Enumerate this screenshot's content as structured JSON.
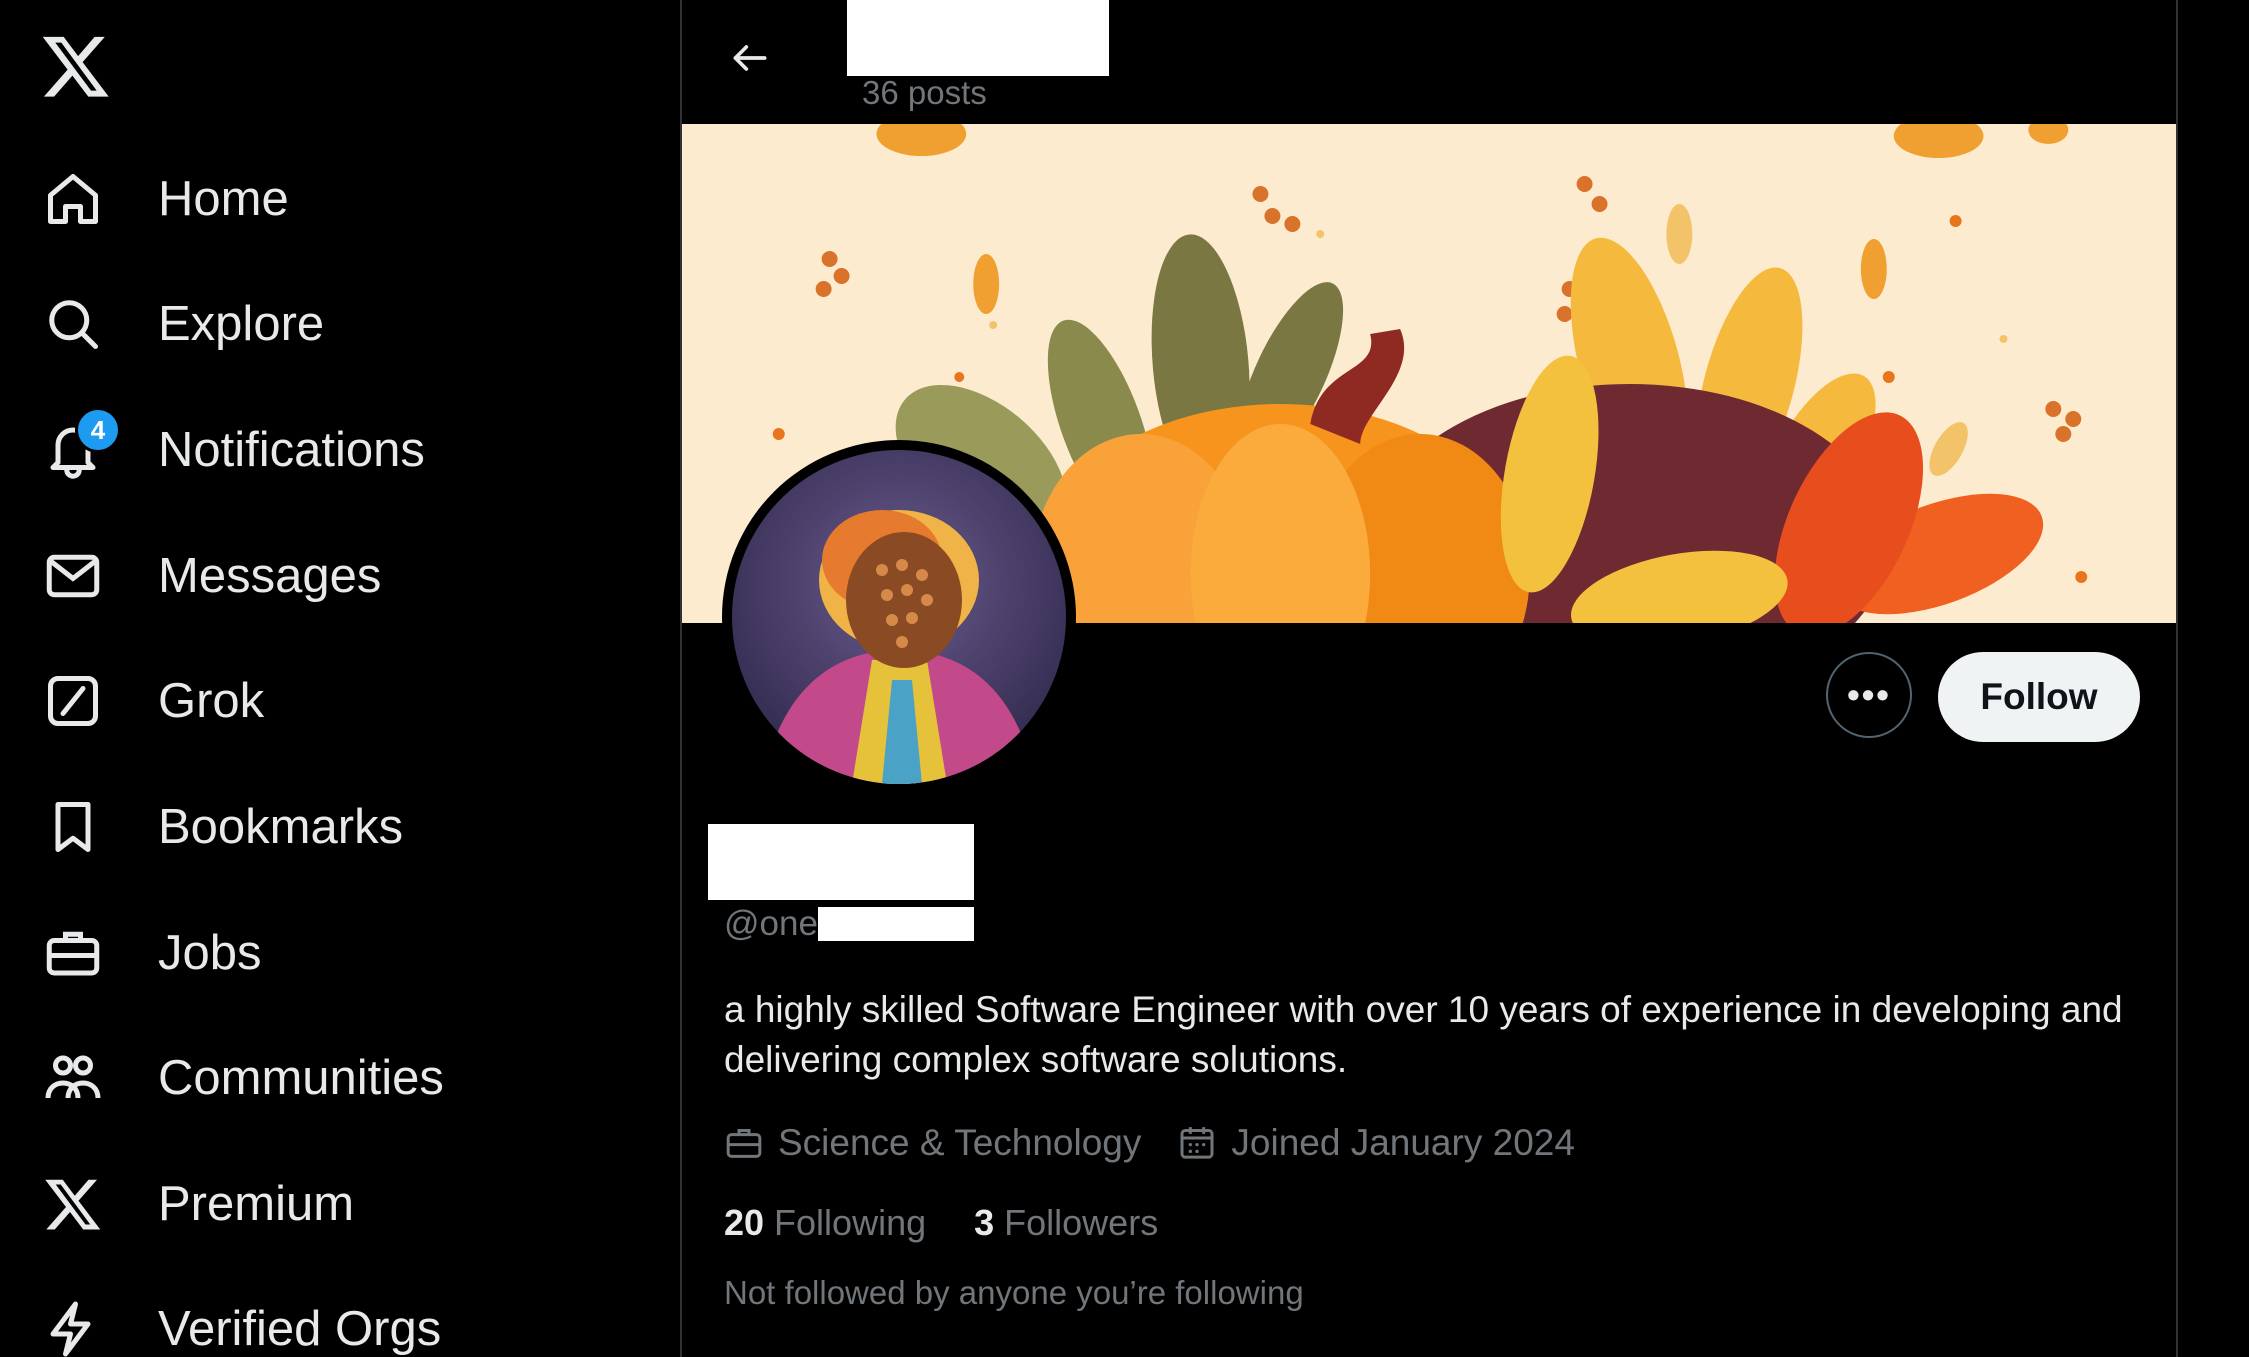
{
  "sidebar": {
    "logo": "x-logo-icon",
    "items": [
      {
        "label": "Home",
        "icon": "home-icon"
      },
      {
        "label": "Explore",
        "icon": "search-icon"
      },
      {
        "label": "Notifications",
        "icon": "bell-icon",
        "badge": "4"
      },
      {
        "label": "Messages",
        "icon": "envelope-icon"
      },
      {
        "label": "Grok",
        "icon": "grok-icon"
      },
      {
        "label": "Bookmarks",
        "icon": "bookmark-icon"
      },
      {
        "label": "Jobs",
        "icon": "briefcase-icon"
      },
      {
        "label": "Communities",
        "icon": "people-icon"
      },
      {
        "label": "Premium",
        "icon": "x-icon"
      },
      {
        "label": "Verified Orgs",
        "icon": "lightning-icon"
      }
    ]
  },
  "header": {
    "posts_count": "36 posts"
  },
  "profile": {
    "handle_prefix": "@one",
    "bio": "a highly skilled Software Engineer with over 10 years of experience in developing and delivering complex software solutions.",
    "category": "Science & Technology",
    "joined": "Joined January 2024",
    "following_count": "20",
    "following_label": "Following",
    "followers_count": "3",
    "followers_label": "Followers",
    "not_followed_text": "Not followed by anyone you’re following",
    "follow_button": "Follow",
    "more_button": "•••"
  },
  "colors": {
    "background": "#000000",
    "text_primary": "#e7e9ea",
    "text_secondary": "#71767b",
    "accent": "#1d9bf0",
    "follow_button_bg": "#eff3f4",
    "banner_bg": "#fdebcf"
  }
}
